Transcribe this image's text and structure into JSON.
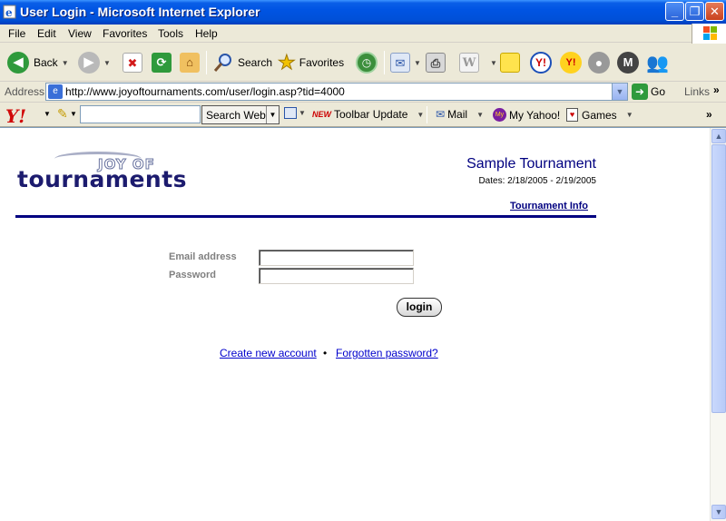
{
  "window": {
    "title": "User Login - Microsoft Internet Explorer"
  },
  "menu": [
    "File",
    "Edit",
    "View",
    "Favorites",
    "Tools",
    "Help"
  ],
  "toolbar": {
    "back_label": "Back",
    "search_label": "Search",
    "favorites_label": "Favorites"
  },
  "address": {
    "label": "Address",
    "url": "http://www.joyoftournaments.com/user/login.asp?tid=4000",
    "go_label": "Go",
    "links_label": "Links"
  },
  "yahoo_toolbar": {
    "logo": "Y!",
    "search_value": "",
    "search_button": "Search Web",
    "new_badge": "NEW",
    "toolbar_update": "Toolbar Update",
    "mail": "Mail",
    "my_yahoo": "My Yahoo!",
    "games": "Games"
  },
  "page": {
    "logo_small": "JOY OF",
    "logo_main": "tournaments",
    "tournament_name": "Sample Tournament",
    "dates": "Dates: 2/18/2005 - 2/19/2005",
    "info_link": "Tournament Info",
    "form": {
      "email_label": "Email address",
      "email_value": "",
      "password_label": "Password",
      "password_value": "",
      "login_button": "login"
    },
    "links": {
      "create_account": "Create new account",
      "separator": "•",
      "forgot_password": "Forgotten password?"
    }
  },
  "colors": {
    "titlebar": "#0054e3",
    "heading": "#000080",
    "link": "#0000cc",
    "label": "#808080"
  }
}
